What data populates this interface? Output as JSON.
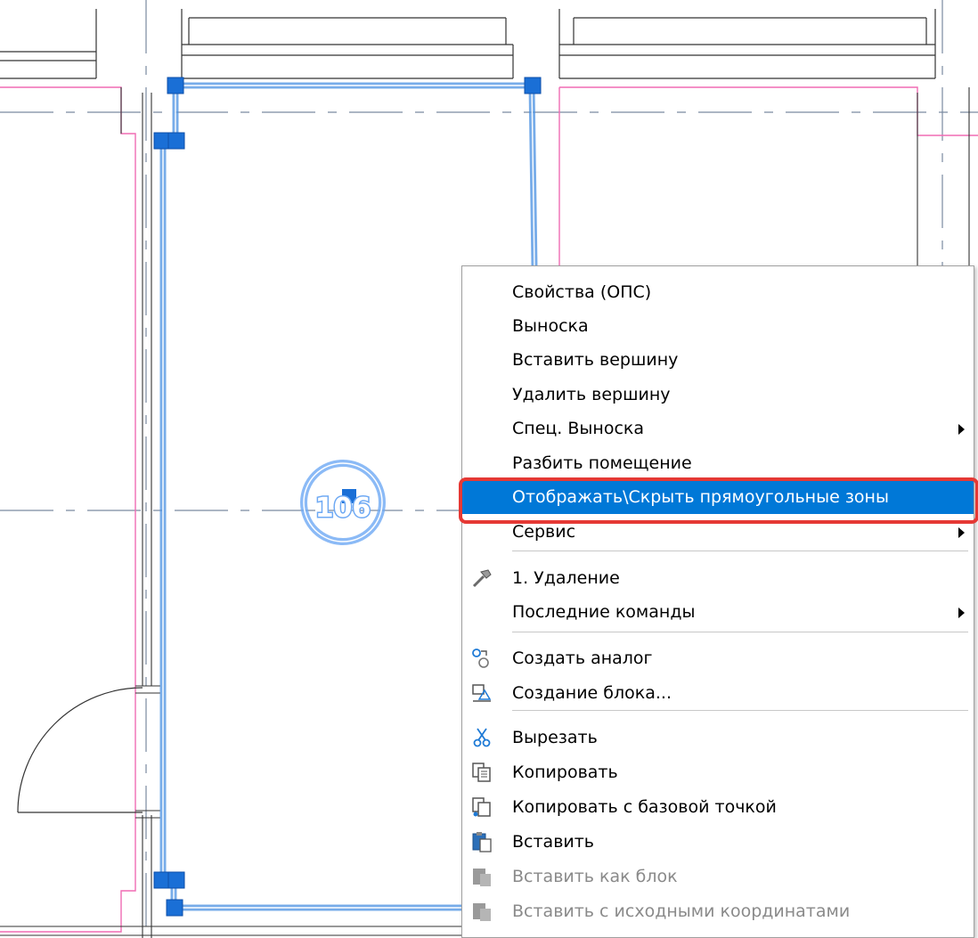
{
  "room": {
    "number": "106"
  },
  "context_menu": {
    "items": [
      {
        "label": "Свойства (ОПС)",
        "submenu": false,
        "disabled": false,
        "icon": null
      },
      {
        "label": "Выноска",
        "submenu": false,
        "disabled": false,
        "icon": null
      },
      {
        "label": "Вставить вершину",
        "submenu": false,
        "disabled": false,
        "icon": null
      },
      {
        "label": "Удалить вершину",
        "submenu": false,
        "disabled": false,
        "icon": null
      },
      {
        "label": "Спец. Выноска",
        "submenu": true,
        "disabled": false,
        "icon": null
      },
      {
        "label": "Разбить помещение",
        "submenu": false,
        "disabled": false,
        "icon": null
      },
      {
        "label": "Отображать\\Скрыть прямоугольные зоны",
        "submenu": false,
        "disabled": false,
        "highlighted": true,
        "icon": null
      },
      {
        "label": "Сервис",
        "submenu": true,
        "disabled": false,
        "icon": null
      },
      {
        "label": "1. Удаление",
        "submenu": false,
        "disabled": false,
        "icon": "hammer-icon"
      },
      {
        "label": "Последние команды",
        "submenu": true,
        "disabled": false,
        "icon": null
      },
      {
        "label": "Создать аналог",
        "submenu": false,
        "disabled": false,
        "icon": "create-similar-icon"
      },
      {
        "label": "Создание блока...",
        "submenu": false,
        "disabled": false,
        "icon": "block-create-icon"
      },
      {
        "label": "Вырезать",
        "submenu": false,
        "disabled": false,
        "icon": "scissors-icon"
      },
      {
        "label": "Копировать",
        "submenu": false,
        "disabled": false,
        "icon": "copy-icon"
      },
      {
        "label": "Копировать с базовой точкой",
        "submenu": false,
        "disabled": false,
        "icon": "copy-base-point-icon"
      },
      {
        "label": "Вставить",
        "submenu": false,
        "disabled": false,
        "icon": "paste-icon"
      },
      {
        "label": "Вставить как блок",
        "submenu": false,
        "disabled": true,
        "icon": "paste-block-icon"
      },
      {
        "label": "Вставить с исходными координатами",
        "submenu": false,
        "disabled": true,
        "icon": "paste-original-coords-icon"
      }
    ]
  },
  "colors": {
    "selection_blue": "#4a90e2",
    "grip_blue": "#1a6fd6",
    "highlight_bg": "#0078d7",
    "annotation_red": "#e53935",
    "wall_magenta": "#f06cb4",
    "axis_gray": "#7a8aa0"
  }
}
